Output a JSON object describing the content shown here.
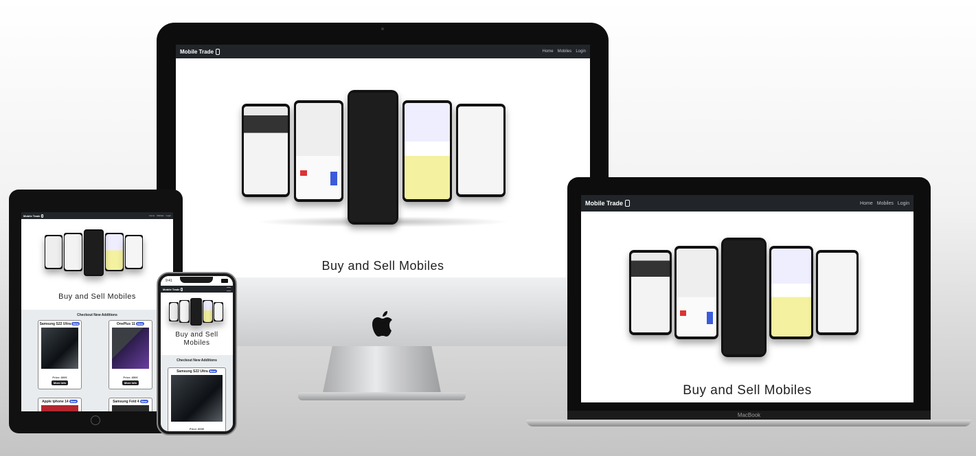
{
  "site": {
    "brand": "Mobile Trade",
    "nav": [
      "Home",
      "Mobiles",
      "Login"
    ],
    "headline": "Buy and Sell Mobiles",
    "headline_phone": "Buy and Sell Mobiles",
    "additions_title": "Checkout New Additions",
    "new_badge": "New",
    "more_info": "More Info",
    "cards": [
      {
        "name": "Samsung S22 Ultra",
        "price": "Price: 800€"
      },
      {
        "name": "OnePlus 11",
        "price": "Price: 850€"
      },
      {
        "name": "Apple Iphone 14",
        "price": ""
      },
      {
        "name": "Samsung Fold 4",
        "price": ""
      }
    ]
  },
  "devices": {
    "laptop_label": "MacBook",
    "phone_time": "9:41"
  },
  "colors": {
    "navbar": "#212529",
    "badge": "#3b5bdb",
    "strip": "#e9ecef"
  }
}
